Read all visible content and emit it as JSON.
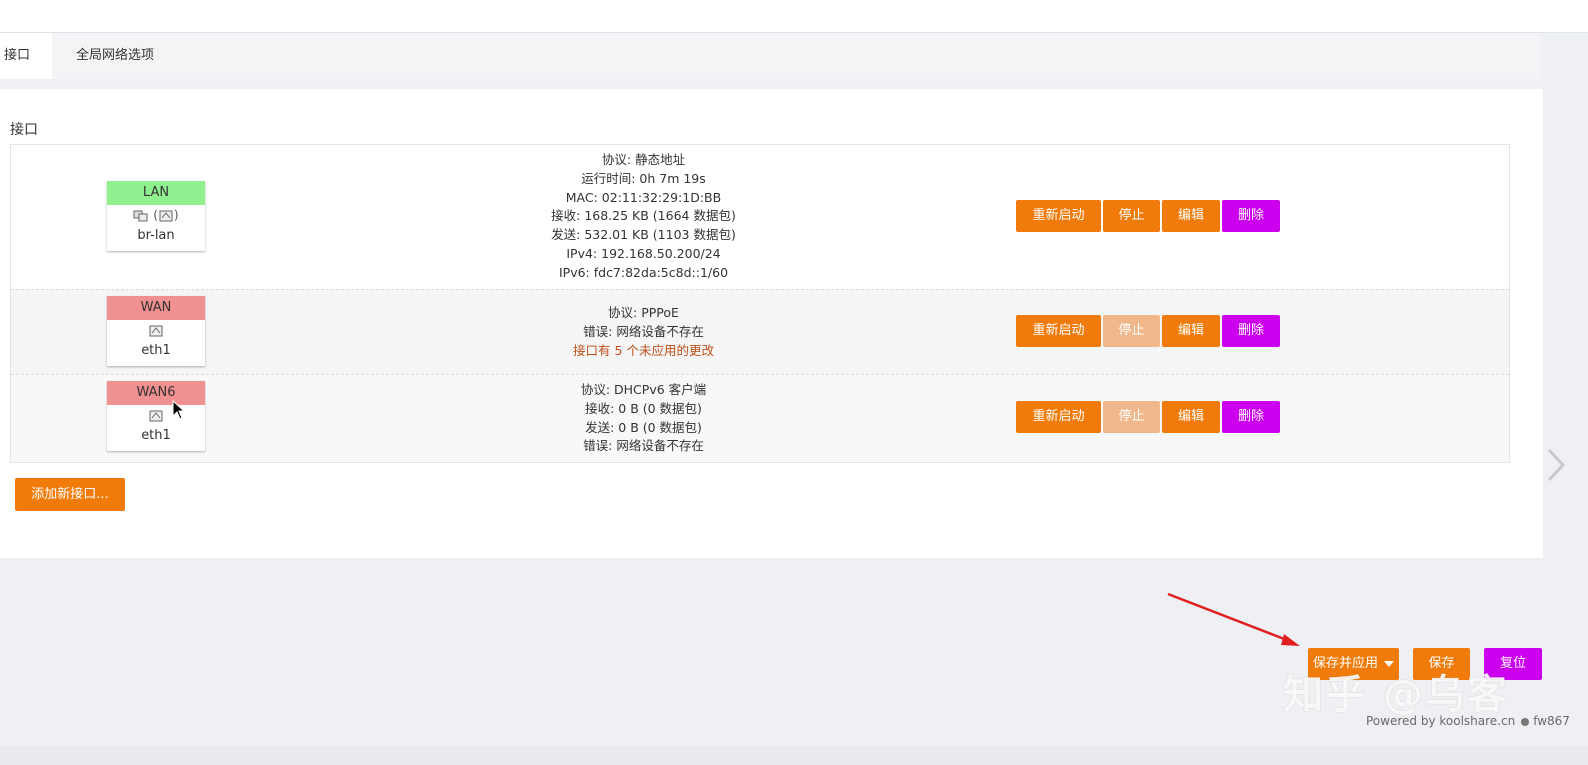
{
  "tabs": [
    {
      "label": "接口"
    },
    {
      "label": "全局网络选项"
    }
  ],
  "section_title": "接口",
  "interfaces": [
    {
      "name": "LAN",
      "icons": "(  )",
      "device": "br-lan",
      "status": [
        "协议: 静态地址",
        "运行时间: 0h 7m 19s",
        "MAC: 02:11:32:29:1D:BB",
        "接收: 168.25 KB (1664 数据包)",
        "发送: 532.01 KB (1103 数据包)",
        "IPv4: 192.168.50.200/24",
        "IPv6: fdc7:82da:5c8d::1/60"
      ]
    },
    {
      "name": "WAN",
      "device": "eth1",
      "status": [
        "协议: PPPoE",
        "错误: 网络设备不存在"
      ],
      "warning": "接口有 5 个未应用的更改"
    },
    {
      "name": "WAN6",
      "device": "eth1",
      "status": [
        "协议: DHCPv6 客户端",
        "接收: 0 B (0 数据包)",
        "发送: 0 B (0 数据包)",
        "错误: 网络设备不存在"
      ]
    }
  ],
  "buttons": {
    "restart": "重新启动",
    "stop": "停止",
    "edit": "编辑",
    "delete": "删除"
  },
  "add_interface": "添加新接口...",
  "footer": {
    "save_apply": "保存并应用",
    "save": "保存",
    "reset": "复位"
  },
  "watermark": "知乎 @乌客",
  "powered_by": "Powered by koolshare.cn",
  "powered_user": "fw867",
  "colors": {
    "accent_orange": "#f07b0a",
    "faded_orange": "#f0b88a",
    "purple": "#cc00ee",
    "lan_green": "#90f090",
    "wan_red": "#f09090",
    "arrow_red": "#e02020"
  }
}
